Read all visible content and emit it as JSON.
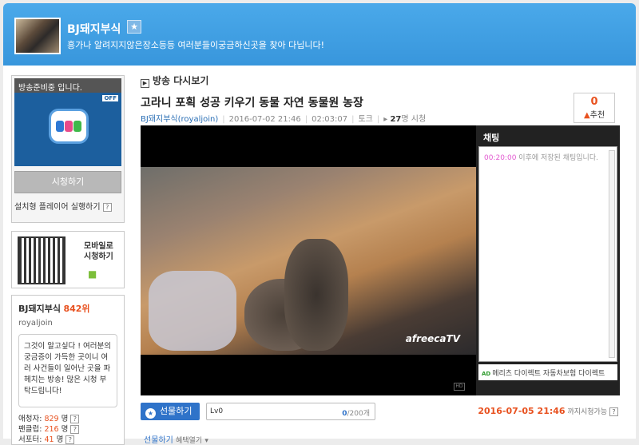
{
  "header": {
    "title": "BJ돼지부식",
    "description": "흥가나 알려지지않은장소등등 여러분들이궁금하신곳을 찾아 다닙니다!"
  },
  "broadcast": {
    "status_label": "방송준비중 입니다.",
    "off_badge": "OFF",
    "watch_label": "시청하기",
    "install_label": "설치형 플레이어 실행하기"
  },
  "mobile": {
    "label_line1": "모바일로",
    "label_line2": "시청하기"
  },
  "bj": {
    "name": "BJ돼지부식",
    "rank": "842위",
    "id": "royaljoin",
    "intro": "그것이 알고싶다 ! 여러분의 궁금증이 가득한 곳이니 여러 사건들이 일어난 곳을 파헤치는 방송! 많은 시청 부탁드립니다!",
    "fans_label": "애청자:",
    "fans_count": "829",
    "fans_unit": "명",
    "viewers_label": "팬클럽:",
    "viewers_count": "216",
    "viewers_unit": "명",
    "supporters_label": "서포터:",
    "supporters_count": "41",
    "supporters_unit": "명"
  },
  "section_title": "방송 다시보기",
  "video": {
    "title": "고라니 포획 성공 키우기 동물 자연 동물원 농장",
    "author": "BJ돼지부식(royaljoin)",
    "date": "2016-07-02 21:46",
    "duration": "02:03:07",
    "category": "토크",
    "views": "27",
    "views_suffix": "명 시청",
    "watermark": "afreecaTV"
  },
  "recommend": {
    "count": "0",
    "label": "추천"
  },
  "chat": {
    "header": "채팅",
    "notice_time": "00:20:00",
    "notice_text": "이후에 저장된 채팅입니다.",
    "ad_tag": "AD",
    "ad_text": "메리츠 다이렉트 자동차보험 다이렉트"
  },
  "gift": {
    "button_label": "선물하기",
    "level": "Lv0",
    "count_current": "0",
    "count_total": "/200개",
    "expire_date": "2016-07-05 21:46",
    "expire_suffix": "까지시청가능",
    "more_label": "선물하기",
    "more_sub": "혜택열기"
  }
}
